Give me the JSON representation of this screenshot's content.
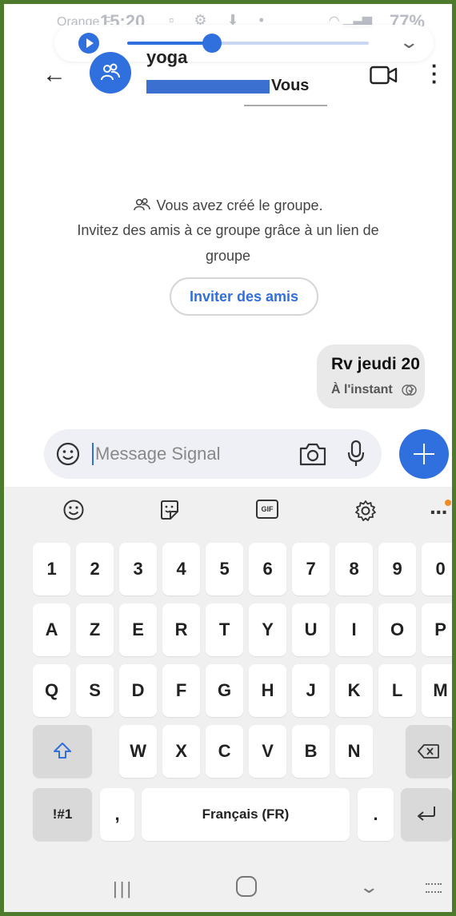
{
  "status": {
    "carrier": "Orange F",
    "time": "15:20",
    "battery": "77%"
  },
  "media": {
    "progress": 0.35,
    "play_icon": "play-icon",
    "collapse_icon": "chevron-down-icon"
  },
  "header": {
    "group_name": "yoga",
    "members_suffix": "Vous"
  },
  "conversation": {
    "created_text": "Vous avez créé le groupe.",
    "invite_text_line1": "Invitez des amis à ce groupe grâce à un lien de",
    "invite_text_line2": "groupe",
    "invite_button": "Inviter des amis",
    "message": {
      "text": "Rv jeudi 20",
      "time": "À l'instant"
    }
  },
  "composer": {
    "placeholder": "Message Signal"
  },
  "keyboard": {
    "toolbar": [
      "emoji-icon",
      "sticker-icon",
      "gif-icon",
      "settings-icon",
      "more-icon"
    ],
    "gif_label": "GIF",
    "row_numbers": [
      "1",
      "2",
      "3",
      "4",
      "5",
      "6",
      "7",
      "8",
      "9",
      "0"
    ],
    "row1": [
      "A",
      "Z",
      "E",
      "R",
      "T",
      "Y",
      "U",
      "I",
      "O",
      "P"
    ],
    "row2": [
      "Q",
      "S",
      "D",
      "F",
      "G",
      "H",
      "J",
      "K",
      "L",
      "M"
    ],
    "row3": [
      "W",
      "X",
      "C",
      "V",
      "B",
      "N"
    ],
    "symbols_key": "!#1",
    "comma_key": ",",
    "space_label": "Français (FR)",
    "period_key": "."
  },
  "colors": {
    "accent": "#2f6fde",
    "frame": "#4d7a2b",
    "bubble": "#e9e9e9",
    "keyboard_bg": "#f0f0f0"
  }
}
